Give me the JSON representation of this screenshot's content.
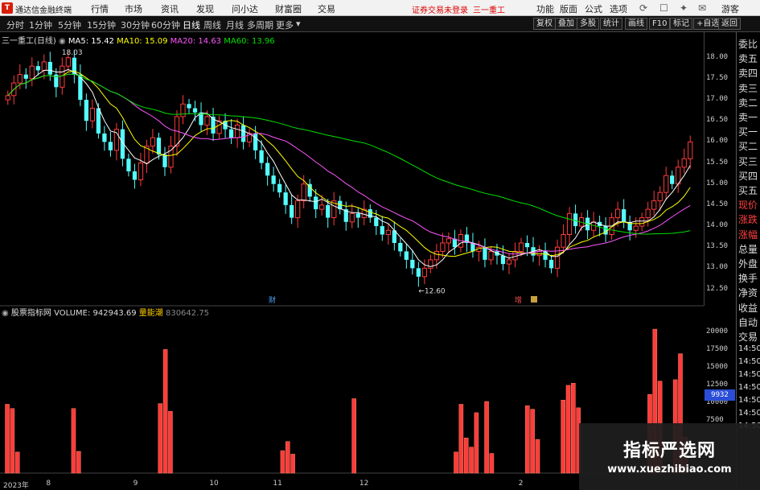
{
  "app": {
    "brand": "通达信金融终端",
    "menu": [
      "行情",
      "市场",
      "资讯",
      "发现",
      "问小达",
      "财富圈",
      "交易"
    ],
    "warning": "证券交易未登录",
    "stock_title": "三一重工",
    "right_menu": [
      "功能",
      "版面",
      "公式",
      "选项"
    ],
    "guest": "游客",
    "icons": [
      "refresh-icon",
      "chat-icon",
      "skin-icon",
      "mail-icon"
    ]
  },
  "periods": [
    "分时",
    "1分钟",
    "5分钟",
    "15分钟",
    "30分钟",
    "60分钟",
    "日线",
    "周线",
    "月线",
    "多周期",
    "更多"
  ],
  "active_period": "日线",
  "toolbar_right": [
    "复权",
    "叠加",
    "多股",
    "统计",
    "画线",
    "F10",
    "标记",
    "+自选",
    "返回"
  ],
  "ma_info": {
    "name": "三一重工(日线)",
    "ma5": "MA5: 15.42",
    "ma10": "MA10: 15.09",
    "ma20": "MA20: 14.63",
    "ma60": "MA60: 13.96"
  },
  "vol_info": {
    "name": "股票指标网",
    "volume": "VOLUME: 942943.69",
    "label2": "量能潮",
    "value2": "830642.75"
  },
  "price_ticks": [
    "18.00",
    "17.50",
    "17.00",
    "16.50",
    "16.00",
    "15.50",
    "15.00",
    "14.50",
    "14.00",
    "13.50",
    "13.00",
    "12.50"
  ],
  "vol_ticks": [
    "20000",
    "17500",
    "15000",
    "12500",
    "10000",
    "7500"
  ],
  "current_vol_badge": "9932",
  "annotations": {
    "high": "18.03",
    "low": "12.60",
    "cai": "财",
    "zeng": "增"
  },
  "x_labels": [
    {
      "text": "2023年",
      "pos": 0.0
    },
    {
      "text": "8",
      "pos": 0.062
    },
    {
      "text": "9",
      "pos": 0.188
    },
    {
      "text": "10",
      "pos": 0.298
    },
    {
      "text": "11",
      "pos": 0.39
    },
    {
      "text": "12",
      "pos": 0.515
    },
    {
      "text": "2",
      "pos": 0.745
    }
  ],
  "side_panel": [
    "委比",
    "卖五",
    "卖四",
    "卖三",
    "卖二",
    "卖一",
    "买一",
    "买二",
    "买三",
    "买四",
    "买五",
    "现价",
    "涨跌",
    "涨幅",
    "总量",
    "外盘",
    "换手",
    "净资",
    "收益",
    "自动",
    "交易",
    "14:50",
    "14:50",
    "14:50",
    "14:50",
    "14:50",
    "14:50",
    "14:50"
  ],
  "side_panel_red": [
    11,
    12,
    13
  ],
  "watermark": {
    "line1": "指标严选网",
    "line2": "www.xuezhibiao.com"
  },
  "colors": {
    "up": "#ff3c3c",
    "down": "#54ffff",
    "ma5": "#ffffff",
    "ma10": "#ffff00",
    "ma20": "#ff55ff",
    "ma60": "#00e000",
    "vol": "#ff3c3c",
    "vol_down": "#00e0e0"
  },
  "chart_data": {
    "type": "candlestick",
    "ylim": [
      12.3,
      18.3
    ],
    "close_series": [
      17.1,
      17.4,
      17.6,
      17.5,
      17.8,
      17.7,
      17.9,
      17.6,
      17.3,
      17.8,
      18.0,
      17.6,
      17.0,
      16.5,
      16.8,
      16.2,
      16.0,
      15.8,
      16.3,
      15.6,
      15.3,
      15.1,
      15.5,
      15.9,
      16.1,
      15.7,
      15.4,
      15.9,
      16.6,
      16.9,
      16.8,
      16.7,
      16.4,
      16.6,
      16.2,
      16.5,
      16.3,
      16.1,
      16.4,
      16.0,
      16.2,
      15.8,
      15.5,
      15.2,
      15.0,
      14.8,
      14.5,
      14.2,
      14.6,
      15.0,
      14.7,
      14.4,
      14.5,
      14.2,
      14.6,
      14.4,
      14.1,
      14.3,
      14.2,
      14.4,
      14.2,
      14.0,
      13.8,
      13.9,
      13.6,
      13.4,
      13.2,
      13.0,
      12.8,
      13.0,
      13.2,
      13.4,
      13.6,
      13.7,
      13.5,
      13.8,
      13.6,
      13.4,
      13.5,
      13.2,
      13.4,
      13.3,
      13.1,
      13.2,
      13.4,
      13.6,
      13.5,
      13.3,
      13.4,
      13.2,
      13.0,
      13.5,
      13.8,
      14.3,
      14.0,
      14.2,
      13.9,
      14.1,
      14.0,
      13.8,
      14.2,
      14.4,
      14.1,
      13.9,
      14.0,
      14.2,
      14.4,
      14.6,
      14.8,
      15.2,
      15.0,
      15.4,
      15.6,
      16.0
    ],
    "volume_series": [
      9800,
      9200,
      3000,
      0,
      0,
      0,
      0,
      0,
      0,
      0,
      0,
      0,
      0,
      9200,
      3100,
      0,
      0,
      0,
      0,
      0,
      0,
      0,
      0,
      0,
      0,
      0,
      0,
      0,
      0,
      0,
      9900,
      17600,
      8800,
      0,
      0,
      0,
      0,
      0,
      0,
      0,
      0,
      0,
      0,
      0,
      0,
      0,
      0,
      0,
      0,
      0,
      0,
      0,
      0,
      0,
      3200,
      4500,
      2700,
      0,
      0,
      0,
      0,
      0,
      0,
      0,
      0,
      0,
      0,
      0,
      10600,
      0,
      0,
      0,
      0,
      0,
      0,
      0,
      0,
      0,
      0,
      0,
      0,
      0,
      0,
      0,
      0,
      0,
      0,
      0,
      3000,
      9800,
      5000,
      3700,
      8600,
      0,
      10200,
      2800,
      0,
      0,
      0,
      0,
      0,
      0,
      9600,
      9100,
      4800,
      0,
      0,
      0,
      0,
      10400,
      12500,
      12800,
      9300,
      0,
      0,
      0,
      0,
      0,
      0,
      0,
      0,
      0,
      0,
      0,
      0,
      0,
      11200,
      20500,
      13100,
      0,
      0,
      13300,
      17000,
      5100,
      0
    ],
    "vol_ylim": [
      0,
      22000
    ],
    "candles_n": 114
  }
}
